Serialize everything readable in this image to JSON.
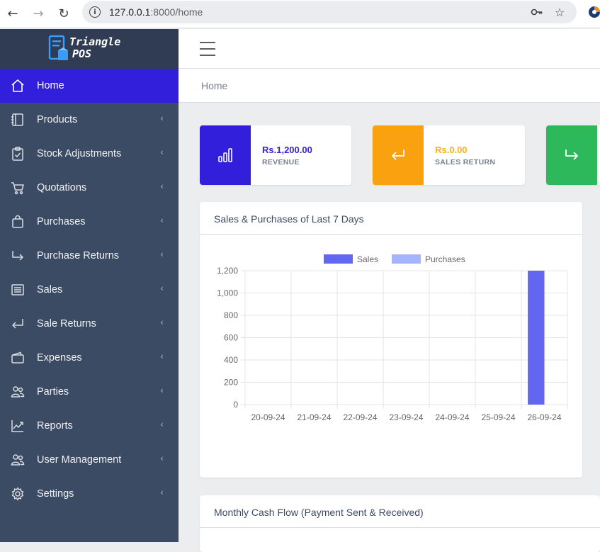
{
  "browser": {
    "url_host": "127.0.0.1",
    "url_rest": ":8000/home"
  },
  "brand": {
    "line1": "Triangle",
    "line2": "POS"
  },
  "sidebar": {
    "items": [
      {
        "label": "Home",
        "icon": "home-icon",
        "active": true
      },
      {
        "label": "Products",
        "icon": "book-icon"
      },
      {
        "label": "Stock Adjustments",
        "icon": "clipboard-check-icon"
      },
      {
        "label": "Quotations",
        "icon": "cart-icon"
      },
      {
        "label": "Purchases",
        "icon": "bag-icon"
      },
      {
        "label": "Purchase Returns",
        "icon": "arrow-return-right-icon"
      },
      {
        "label": "Sales",
        "icon": "receipt-icon"
      },
      {
        "label": "Sale Returns",
        "icon": "arrow-return-left-icon"
      },
      {
        "label": "Expenses",
        "icon": "wallet-icon"
      },
      {
        "label": "Parties",
        "icon": "people-icon"
      },
      {
        "label": "Reports",
        "icon": "graph-up-icon"
      },
      {
        "label": "User Management",
        "icon": "people-icon"
      },
      {
        "label": "Settings",
        "icon": "gear-icon"
      }
    ]
  },
  "breadcrumb": "Home",
  "widgets": [
    {
      "value": "Rs.1,200.00",
      "label": "REVENUE",
      "color": "#321fdb",
      "icon": "bar-chart-icon"
    },
    {
      "value": "Rs.0.00",
      "label": "SALES RETURN",
      "color": "#f9b115",
      "icon": "arrow-return-left-icon"
    },
    {
      "value": "",
      "label": "",
      "color": "#2eb85c",
      "icon": "arrow-return-right-icon"
    }
  ],
  "cards": {
    "sales_purchases_title": "Sales & Purchases of Last 7 Days",
    "cash_flow_title": "Monthly Cash Flow (Payment Sent & Received)"
  },
  "chart_data": {
    "type": "bar",
    "categories": [
      "20-09-24",
      "21-09-24",
      "22-09-24",
      "23-09-24",
      "24-09-24",
      "25-09-24",
      "26-09-24"
    ],
    "series": [
      {
        "name": "Sales",
        "values": [
          0,
          0,
          0,
          0,
          0,
          0,
          1200
        ],
        "color": "#6366f1"
      },
      {
        "name": "Purchases",
        "values": [
          0,
          0,
          0,
          0,
          0,
          0,
          0
        ],
        "color": "#a5b4fc"
      }
    ],
    "yticks": [
      "0",
      "200",
      "400",
      "600",
      "800",
      "1,000",
      "1,200"
    ],
    "ylim": [
      0,
      1200
    ],
    "grid": true,
    "legend": "top-center"
  }
}
